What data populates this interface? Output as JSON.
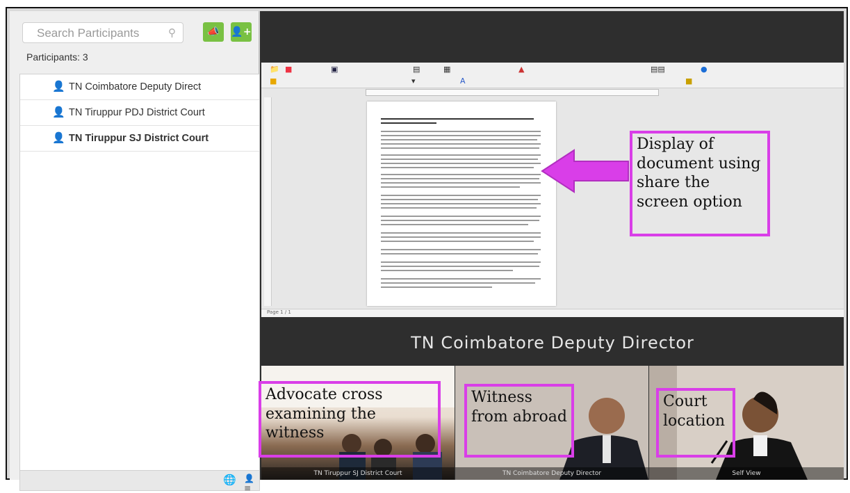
{
  "left_panel": {
    "search_placeholder": "Search Participants",
    "participants_count": "Participants: 3",
    "participants": [
      {
        "name": "TN Coimbatore Deputy  Direct",
        "bold": false
      },
      {
        "name": "TN Tiruppur PDJ District Court",
        "bold": false
      },
      {
        "name": "TN Tiruppur SJ District Court",
        "bold": true
      }
    ]
  },
  "main": {
    "active_speaker": "TN Coimbatore Deputy  Director",
    "doc_status": "Page 1 / 1",
    "thumbnails": [
      {
        "caption": "TN Tiruppur SJ District Court"
      },
      {
        "caption": "TN Coimbatore Deputy  Director"
      },
      {
        "caption": "Self View"
      }
    ]
  },
  "annotations": {
    "display_doc": "Display of document using share the screen option",
    "advocate": "Advocate cross examining the witness",
    "witness": "Witness from abroad",
    "court": "Court location"
  },
  "colors": {
    "highlight": "#d93ee8",
    "participant_icon": "#5fae2e",
    "button_green": "#79c143"
  },
  "icons": {
    "participant": "user-icon",
    "search": "search-icon",
    "add_user": "add-user-icon",
    "globe": "globe-icon"
  }
}
